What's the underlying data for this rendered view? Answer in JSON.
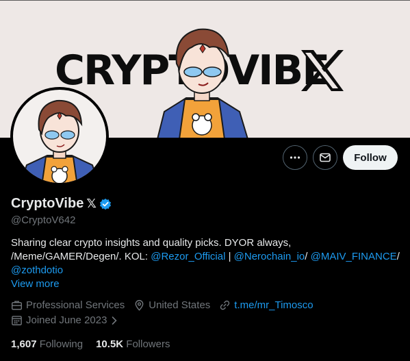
{
  "banner": {
    "title": "CRYPTOVIBE",
    "title_suffix_icon": "x-logo-icon"
  },
  "actions": {
    "more_icon": "more-dots-icon",
    "message_icon": "envelope-icon",
    "follow_label": "Follow"
  },
  "profile": {
    "name": "CryptoVibe",
    "name_suffix": "𝕏",
    "verified_icon": "verified-badge-icon",
    "handle": "@CryptoV642",
    "bio_text_1": "Sharing clear crypto insights and quality picks. DYOR always, /Meme/GAMER/Degen/. KOL: ",
    "bio_links": [
      "@Rezor_Official",
      "@Nerochain_io",
      "@MAIV_FINANCE",
      "@zothdotio"
    ],
    "bio_sep_1": " | ",
    "bio_sep_2": "/ ",
    "bio_sep_3": "/",
    "view_more": "View more"
  },
  "meta": {
    "category": "Professional Services",
    "location": "United States",
    "website": "t.me/mr_Timosco",
    "joined": "Joined June 2023"
  },
  "stats": {
    "following_count": "1,607",
    "following_label": "Following",
    "followers_count": "10.5K",
    "followers_label": "Followers"
  },
  "colors": {
    "accent": "#1d9bf0",
    "muted": "#71767b",
    "text": "#e7e9ea",
    "banner_bg": "#eee8e6"
  }
}
